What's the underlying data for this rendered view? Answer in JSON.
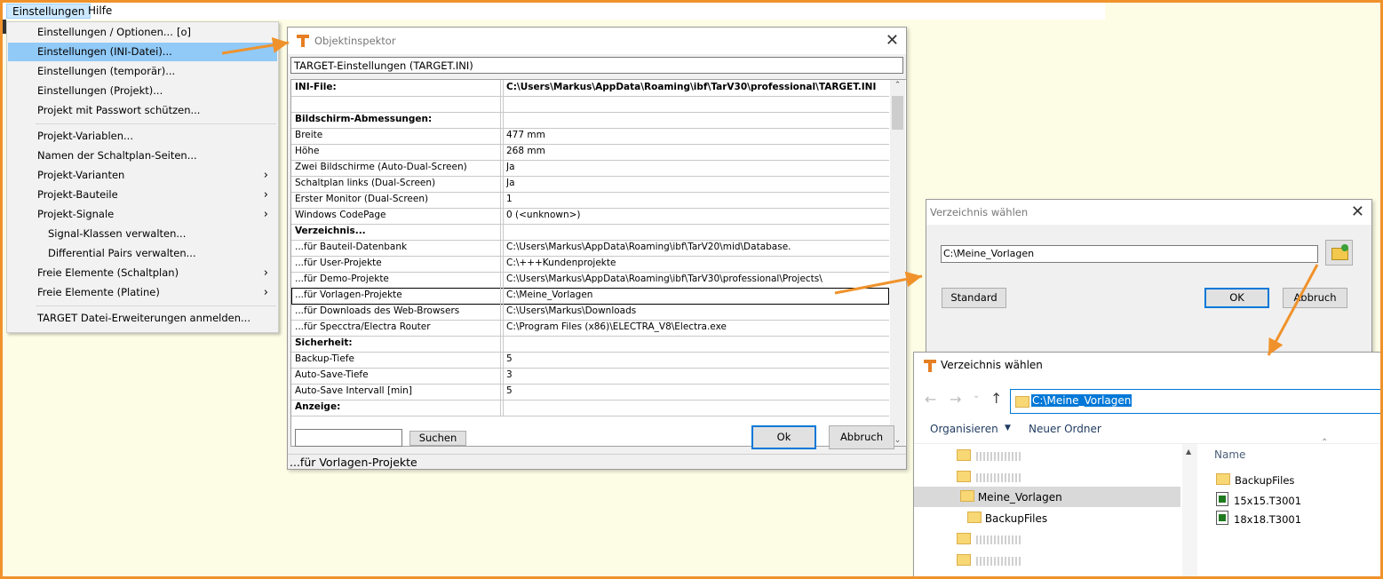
{
  "menubar": {
    "items": [
      "Einstellungen",
      "Hilfe"
    ]
  },
  "dropdown": {
    "items": [
      {
        "label": "Einstellungen / Optionen...",
        "shortcut": "[o]"
      },
      {
        "label": "Einstellungen (INI-Datei)..."
      },
      {
        "label": "Einstellungen (temporär)..."
      },
      {
        "label": "Einstellungen (Projekt)..."
      },
      {
        "label": "Projekt mit Passwort schützen..."
      },
      {
        "label": "Projekt-Variablen..."
      },
      {
        "label": "Namen der Schaltplan-Seiten..."
      },
      {
        "label": "Projekt-Varianten",
        "chevron": "›"
      },
      {
        "label": "Projekt-Bauteile",
        "chevron": "›"
      },
      {
        "label": "Projekt-Signale",
        "chevron": "›"
      },
      {
        "label": "Signal-Klassen verwalten..."
      },
      {
        "label": "Differential Pairs verwalten..."
      },
      {
        "label": "Freie Elemente (Schaltplan)",
        "chevron": "›"
      },
      {
        "label": "Freie Elemente (Platine)",
        "chevron": "›"
      },
      {
        "label": "TARGET Datei-Erweiterungen anmelden..."
      }
    ]
  },
  "inspector": {
    "title": "Objektinspektor",
    "header_field": "TARGET-Einstellungen (TARGET.INI)",
    "rows": [
      {
        "k": "INI-File:",
        "v": "C:\\Users\\Markus\\AppData\\Roaming\\ibf\\TarV30\\professional\\TARGET.INI"
      },
      {
        "k": "",
        "v": ""
      },
      {
        "k": "Bildschirm-Abmessungen:",
        "v": ""
      },
      {
        "k": "Breite",
        "v": "477 mm"
      },
      {
        "k": "Höhe",
        "v": "268 mm"
      },
      {
        "k": "Zwei Bildschirme (Auto-Dual-Screen)",
        "v": "Ja"
      },
      {
        "k": "Schaltplan links (Dual-Screen)",
        "v": "Ja"
      },
      {
        "k": "Erster Monitor (Dual-Screen)",
        "v": "1"
      },
      {
        "k": "Windows CodePage",
        "v": "0 (<unknown>)"
      },
      {
        "k": "Verzeichnis...",
        "v": ""
      },
      {
        "k": "...für Bauteil-Datenbank",
        "v": "C:\\Users\\Markus\\AppData\\Roaming\\ibf\\TarV20\\mid\\Database."
      },
      {
        "k": "...für User-Projekte",
        "v": "C:\\+++Kundenprojekte"
      },
      {
        "k": "...für Demo-Projekte",
        "v": "C:\\Users\\Markus\\AppData\\Roaming\\ibf\\TarV30\\professional\\Projects\\"
      },
      {
        "k": "...für Vorlagen-Projekte",
        "v": "C:\\Meine_Vorlagen"
      },
      {
        "k": "...für Downloads des Web-Browsers",
        "v": "C:\\Users\\Markus\\Downloads"
      },
      {
        "k": "...für Specctra/Electra Router",
        "v": "C:\\Program Files (x86)\\ELECTRA_V8\\Electra.exe"
      },
      {
        "k": "Sicherheit:",
        "v": ""
      },
      {
        "k": "Backup-Tiefe",
        "v": "5"
      },
      {
        "k": "Auto-Save-Tiefe",
        "v": "3"
      },
      {
        "k": "Auto-Save Intervall [min]",
        "v": "5"
      },
      {
        "k": "Anzeige:",
        "v": ""
      }
    ],
    "search_value": "",
    "search_button": "Suchen",
    "ok_button": "Ok",
    "cancel_button": "Abbruch",
    "status": "...für Vorlagen-Projekte"
  },
  "dir_dialog": {
    "title": "Verzeichnis wählen",
    "path_value": "C:\\Meine_Vorlagen",
    "standard_button": "Standard",
    "ok_button": "OK",
    "cancel_button": "Abbruch"
  },
  "explorer": {
    "title": "Verzeichnis wählen",
    "address": "C:\\Meine_Vorlagen",
    "toolbar": {
      "organize": "Organisieren",
      "new_folder": "Neuer Ordner"
    },
    "tree_selected": "Meine_Vorlagen",
    "tree_child": "BackupFiles",
    "column_name": "Name",
    "files": [
      "BackupFiles",
      "15x15.T3001",
      "18x18.T3001"
    ]
  }
}
